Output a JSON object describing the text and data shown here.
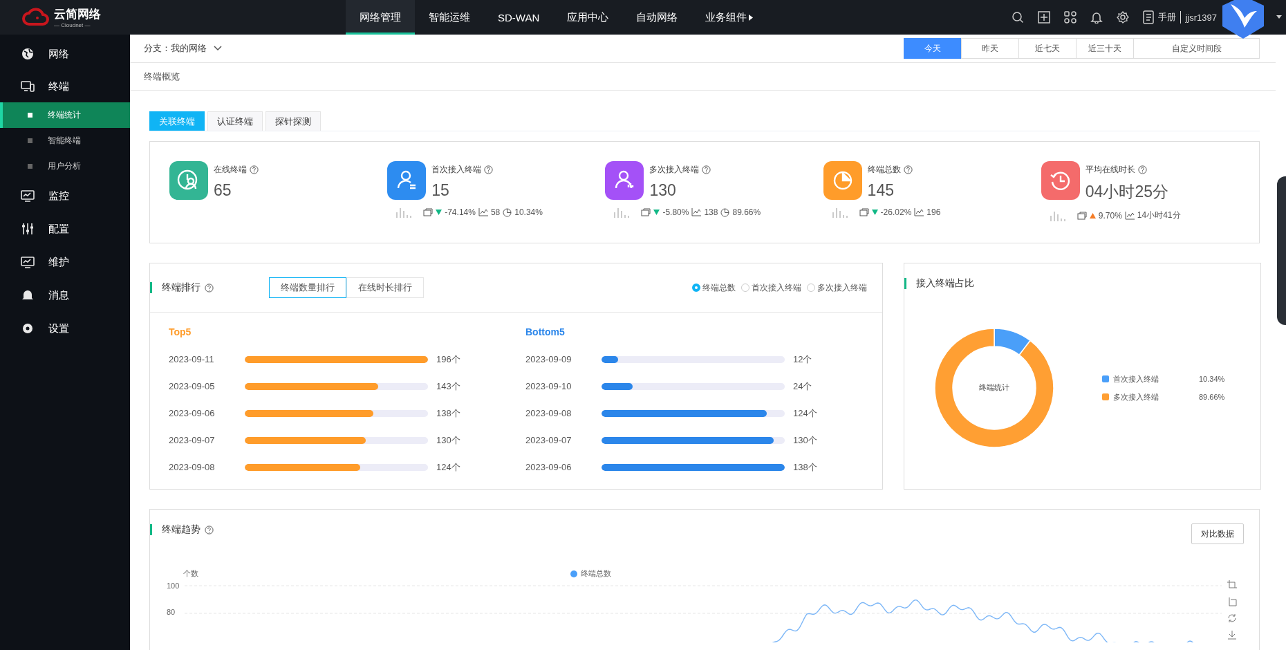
{
  "header": {
    "logo_text": "云简网络",
    "logo_sub": "— Cloudnet —",
    "nav": [
      {
        "label": "网络管理",
        "selected": true,
        "kind": "link"
      },
      {
        "label": "智能运维",
        "selected": false,
        "kind": "link"
      },
      {
        "label": "SD-WAN",
        "selected": false,
        "kind": "link"
      },
      {
        "label": "应用中心",
        "selected": false,
        "kind": "link"
      },
      {
        "label": "自动网络",
        "selected": false,
        "kind": "link"
      },
      {
        "label": "业务组件",
        "selected": false,
        "kind": "menu"
      }
    ],
    "manual": "手册",
    "user": "jjsr1397"
  },
  "sidebar": {
    "items": [
      {
        "label": "网络",
        "expanded": false
      },
      {
        "label": "终端",
        "expanded": true,
        "children": [
          {
            "label": "终端统计",
            "selected": true
          },
          {
            "label": "智能终端",
            "selected": false
          },
          {
            "label": "用户分析",
            "selected": false
          }
        ]
      },
      {
        "label": "监控",
        "expanded": false
      },
      {
        "label": "配置",
        "expanded": false
      },
      {
        "label": "维护",
        "expanded": false
      },
      {
        "label": "消息",
        "expanded": false
      },
      {
        "label": "设置",
        "expanded": false
      }
    ]
  },
  "filter": {
    "label": "分支：",
    "value": "我的网络"
  },
  "date_ranges": [
    {
      "label": "今天",
      "selected": true
    },
    {
      "label": "昨天",
      "selected": false
    },
    {
      "label": "近七天",
      "selected": false
    },
    {
      "label": "近三十天",
      "selected": false
    },
    {
      "label": "自定义时间段",
      "selected": false
    }
  ],
  "breadcrumb": "终端概览",
  "tabs": [
    {
      "label": "关联终端",
      "selected": true
    },
    {
      "label": "认证终端",
      "selected": false
    },
    {
      "label": "探针探测",
      "selected": false
    }
  ],
  "stats": [
    {
      "title": "在线终端",
      "value": "65",
      "color": "#33b594"
    },
    {
      "title": "首次接入终端",
      "value": "15",
      "color": "#2d8cf0",
      "up": false,
      "change": "-74.14%",
      "peak": "58",
      "ratio": "10.34%"
    },
    {
      "title": "多次接入终端",
      "value": "130",
      "color": "#a451f7",
      "up": false,
      "change": "-5.80%",
      "peak": "138",
      "ratio": "89.66%"
    },
    {
      "title": "终端总数",
      "value": "145",
      "color": "#ff9c2a",
      "up": false,
      "change": "-26.02%",
      "peak": "196"
    },
    {
      "title": "平均在线时长",
      "value": "04小时25分",
      "color": "#f46b6b",
      "up": true,
      "change": "9.70%",
      "peak": "14小时41分"
    }
  ],
  "ranking": {
    "title": "终端排行",
    "modes": [
      {
        "label": "终端数量排行",
        "selected": true
      },
      {
        "label": "在线时长排行",
        "selected": false
      }
    ],
    "filters": [
      {
        "label": "终端总数",
        "selected": true
      },
      {
        "label": "首次接入终端",
        "selected": false
      },
      {
        "label": "多次接入终端",
        "selected": false
      }
    ],
    "groups": [
      {
        "title": "Top5",
        "color": "#ff9c2a",
        "rows": [
          {
            "date": "2023-09-11",
            "level": 1.0,
            "count": "196个"
          },
          {
            "date": "2023-09-05",
            "level": 0.73,
            "count": "143个"
          },
          {
            "date": "2023-09-06",
            "level": 0.7,
            "count": "138个"
          },
          {
            "date": "2023-09-07",
            "level": 0.66,
            "count": "130个"
          },
          {
            "date": "2023-09-08",
            "level": 0.63,
            "count": "124个"
          }
        ]
      },
      {
        "title": "Bottom5",
        "color": "#2b86ea",
        "rows": [
          {
            "date": "2023-09-09",
            "level": 0.09,
            "count": "12个"
          },
          {
            "date": "2023-09-10",
            "level": 0.17,
            "count": "24个"
          },
          {
            "date": "2023-09-08",
            "level": 0.9,
            "count": "124个"
          },
          {
            "date": "2023-09-07",
            "level": 0.94,
            "count": "130个"
          },
          {
            "date": "2023-09-06",
            "level": 1.0,
            "count": "138个"
          }
        ]
      }
    ]
  },
  "share": {
    "title": "接入终端占比",
    "center_label": "终端统计",
    "chart_data": {
      "type": "donut",
      "values": [
        10.34,
        89.66
      ]
    },
    "legend": [
      {
        "label": "首次接入终端",
        "value": "10.34%",
        "color": "#4a9ff9"
      },
      {
        "label": "多次接入终端",
        "value": "89.66%",
        "color": "#ff9f33"
      }
    ]
  },
  "trend": {
    "title": "终端趋势",
    "compare_button": "对比数据",
    "ylabel": "个数",
    "legend": "终端总数",
    "yticks": [
      "100",
      "80"
    ]
  }
}
